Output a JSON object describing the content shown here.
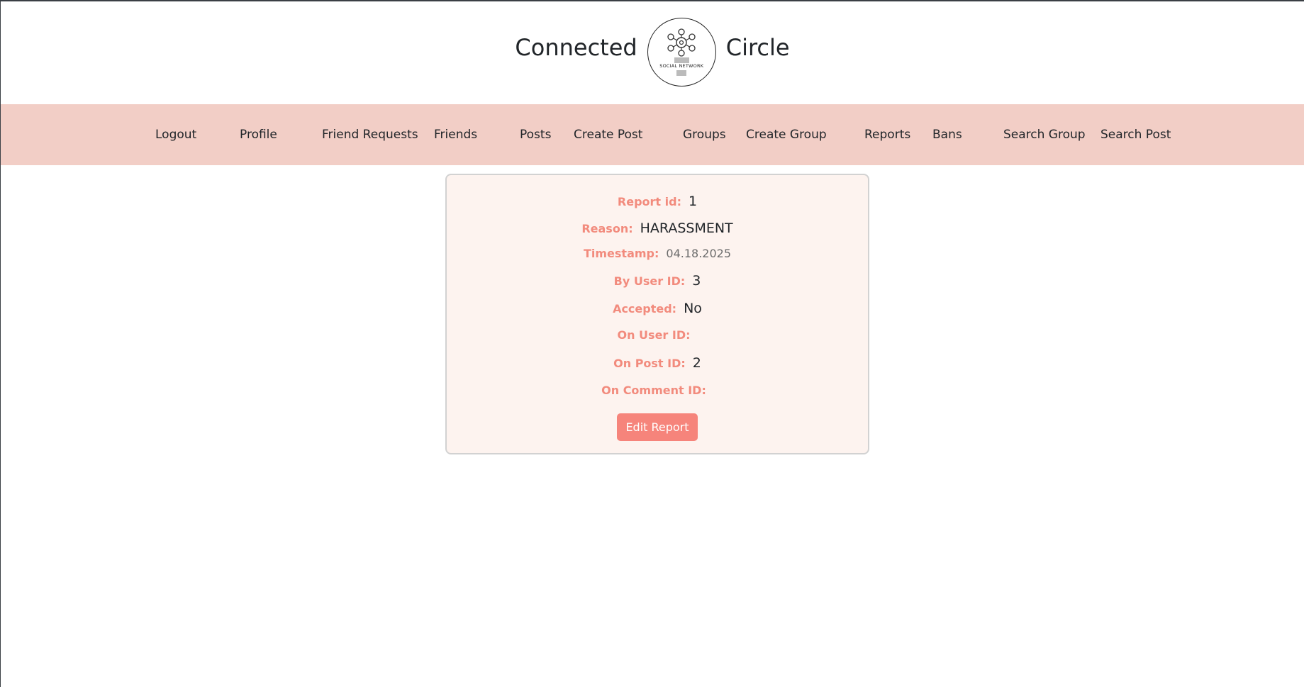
{
  "brand": {
    "left_word": "Connected",
    "right_word": "Circle",
    "logo_icon": "network-logo-icon",
    "logo_tagline": "SOCIAL NETWORK"
  },
  "nav": {
    "items": [
      {
        "label": "Logout"
      },
      {
        "label": "Profile"
      },
      {
        "label": "Friend Requests"
      },
      {
        "label": "Friends"
      },
      {
        "label": "Posts"
      },
      {
        "label": "Create Post"
      },
      {
        "label": "Groups"
      },
      {
        "label": "Create Group"
      },
      {
        "label": "Reports"
      },
      {
        "label": "Bans"
      },
      {
        "label": "Search Group"
      },
      {
        "label": "Search Post"
      }
    ]
  },
  "report": {
    "fields": [
      {
        "label": "Report id:",
        "value": "1"
      },
      {
        "label": "Reason:",
        "value": "HARASSMENT"
      },
      {
        "label": "Timestamp:",
        "value": "04.18.2025"
      },
      {
        "label": "By User ID:",
        "value": "3"
      },
      {
        "label": "Accepted:",
        "value": "No"
      },
      {
        "label": "On User ID:",
        "value": ""
      },
      {
        "label": "On Post ID:",
        "value": "2"
      },
      {
        "label": "On Comment ID:",
        "value": ""
      }
    ],
    "edit_button_label": "Edit Report"
  },
  "colors": {
    "navbar_bg": "#f2cec6",
    "card_bg": "#fdf3ef",
    "label_accent": "#f28b7d",
    "button_bg": "#f6847b"
  }
}
